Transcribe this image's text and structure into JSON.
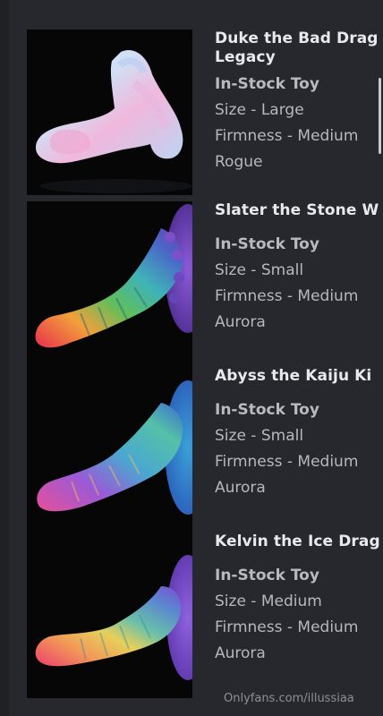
{
  "products": [
    {
      "title_line1": "Duke the Bad Drag",
      "title_line2": "Legacy",
      "type": "In-Stock Toy",
      "size": "Size - Large",
      "firmness": "Firmness - Medium",
      "color": "Rogue"
    },
    {
      "title_line1": "Slater the Stone W",
      "type": "In-Stock Toy",
      "size": "Size - Small",
      "firmness": "Firmness - Medium",
      "color": "Aurora"
    },
    {
      "title_line1": "Abyss the Kaiju Ki",
      "type": "In-Stock Toy",
      "size": "Size - Small",
      "firmness": "Firmness - Medium",
      "color": "Aurora"
    },
    {
      "title_line1": "Kelvin the Ice Drag",
      "type": "In-Stock Toy",
      "size": "Size - Medium",
      "firmness": "Firmness - Medium",
      "color": "Aurora"
    }
  ],
  "watermark": "Onlyfans.com/illussiaa"
}
